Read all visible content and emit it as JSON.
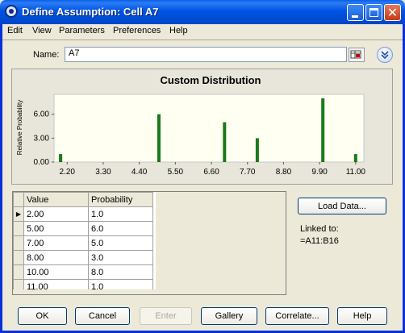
{
  "window": {
    "title": "Define Assumption: Cell A7"
  },
  "menu": [
    "Edit",
    "View",
    "Parameters",
    "Preferences",
    "Help"
  ],
  "name_field": {
    "label": "Name:",
    "value": "A7"
  },
  "chart_data": {
    "type": "bar",
    "title": "Custom Distribution",
    "ylabel": "Relative Probability",
    "xlabel": "",
    "ylim": [
      0,
      8.5
    ],
    "xlim": [
      1.8,
      11.25
    ],
    "x_tick_labels": [
      "2.20",
      "3.30",
      "4.40",
      "5.50",
      "6.60",
      "7.70",
      "8.80",
      "9.90",
      "11.00"
    ],
    "y_tick_labels": [
      "0.00",
      "3.00",
      "6.00"
    ],
    "x": [
      2.0,
      5.0,
      7.0,
      8.0,
      10.0,
      11.0
    ],
    "values": [
      1.0,
      6.0,
      5.0,
      3.0,
      8.0,
      1.0
    ],
    "bar_color": "#1a7a1a",
    "plot_bg": "#fffff2",
    "grid": false
  },
  "table": {
    "columns": [
      "Value",
      "Probability"
    ],
    "rows": [
      [
        "2.00",
        "1.0"
      ],
      [
        "5.00",
        "6.0"
      ],
      [
        "7.00",
        "5.0"
      ],
      [
        "8.00",
        "3.0"
      ],
      [
        "10.00",
        "8.0"
      ],
      [
        "11.00",
        "1.0"
      ]
    ],
    "current_row_marker": "▶"
  },
  "side": {
    "load_label": "Load Data...",
    "linked_label": "Linked to:",
    "linked_value": "=A11:B16"
  },
  "buttons": {
    "ok": "OK",
    "cancel": "Cancel",
    "enter": "Enter",
    "gallery": "Gallery",
    "correlate": "Correlate...",
    "help": "Help"
  }
}
